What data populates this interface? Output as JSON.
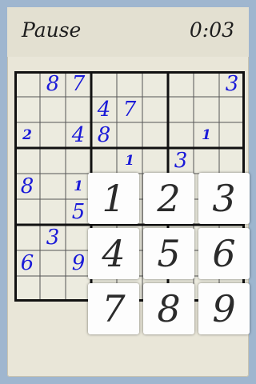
{
  "header": {
    "pause_label": "Pause",
    "timer": "0:03"
  },
  "board": {
    "cells": [
      {
        "r": 0,
        "c": 1,
        "v": "8",
        "size": "big"
      },
      {
        "r": 0,
        "c": 2,
        "v": "7",
        "size": "big"
      },
      {
        "r": 0,
        "c": 8,
        "v": "3",
        "size": "big"
      },
      {
        "r": 1,
        "c": 3,
        "v": "4",
        "size": "big"
      },
      {
        "r": 1,
        "c": 4,
        "v": "7",
        "size": "big"
      },
      {
        "r": 2,
        "c": 0,
        "v": "2",
        "size": "small"
      },
      {
        "r": 2,
        "c": 2,
        "v": "4",
        "size": "big"
      },
      {
        "r": 2,
        "c": 3,
        "v": "8",
        "size": "big"
      },
      {
        "r": 2,
        "c": 7,
        "v": "1",
        "size": "small"
      },
      {
        "r": 3,
        "c": 4,
        "v": "1",
        "size": "small"
      },
      {
        "r": 3,
        "c": 6,
        "v": "3",
        "size": "big"
      },
      {
        "r": 4,
        "c": 0,
        "v": "8",
        "size": "big"
      },
      {
        "r": 4,
        "c": 2,
        "v": "1",
        "size": "small"
      },
      {
        "r": 5,
        "c": 2,
        "v": "5",
        "size": "big"
      },
      {
        "r": 6,
        "c": 1,
        "v": "3",
        "size": "big"
      },
      {
        "r": 7,
        "c": 0,
        "v": "6",
        "size": "big"
      },
      {
        "r": 7,
        "c": 2,
        "v": "9",
        "size": "big"
      }
    ]
  },
  "keypad": {
    "keys": [
      "1",
      "2",
      "3",
      "4",
      "5",
      "6",
      "7",
      "8",
      "9"
    ]
  }
}
